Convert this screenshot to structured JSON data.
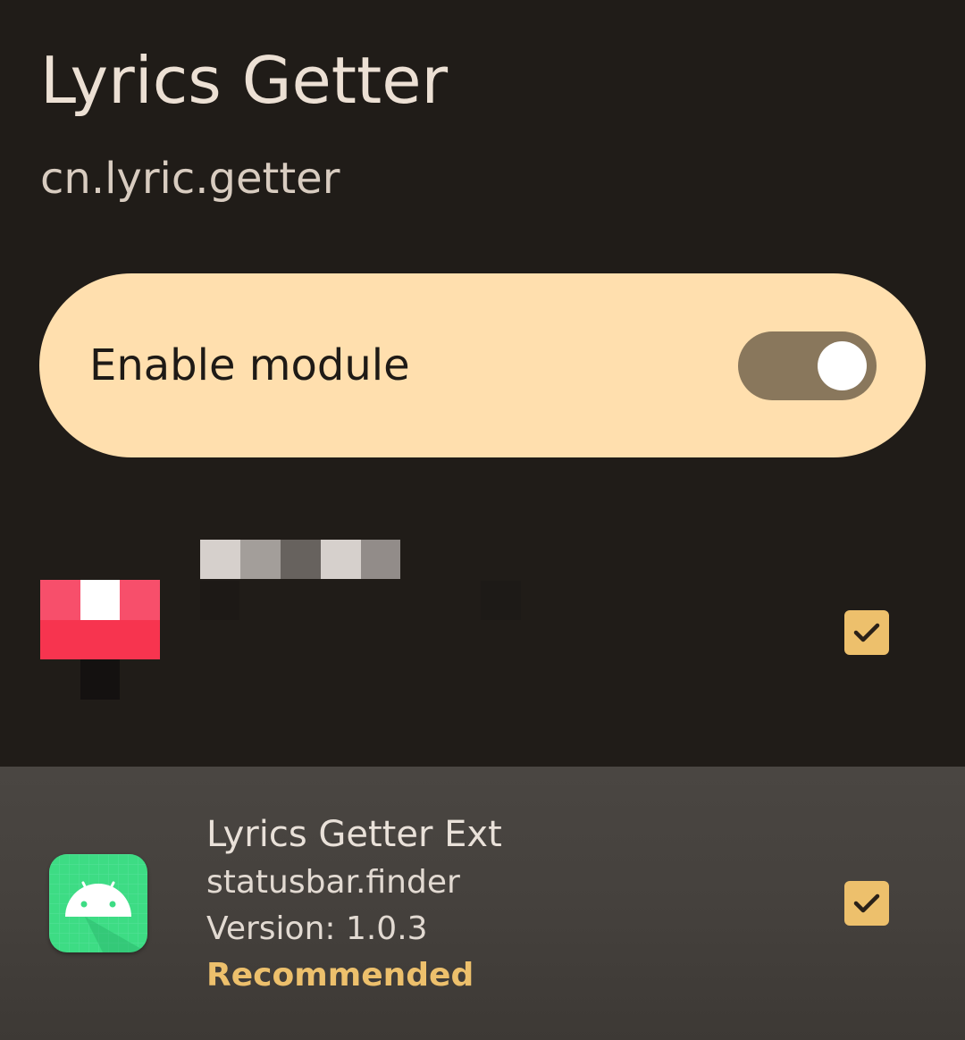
{
  "header": {
    "app_title": "Lyrics Getter",
    "package_name": "cn.lyric.getter"
  },
  "enable_card": {
    "label": "Enable module",
    "enabled": true
  },
  "scope_list": [
    {
      "name": "",
      "package": "",
      "checked": true,
      "redacted": true,
      "icon": "pixelated-app-icon"
    },
    {
      "name": "Lyrics Getter Ext",
      "package": "statusbar.finder",
      "version": "Version: 1.0.3",
      "badge": "Recommended",
      "checked": true,
      "icon": "android-icon"
    }
  ],
  "colors": {
    "background": "#201c18",
    "card": "#ffdfae",
    "accent": "#edc06c",
    "switch_track": "#89775c",
    "highlight_row": "#46423e"
  }
}
